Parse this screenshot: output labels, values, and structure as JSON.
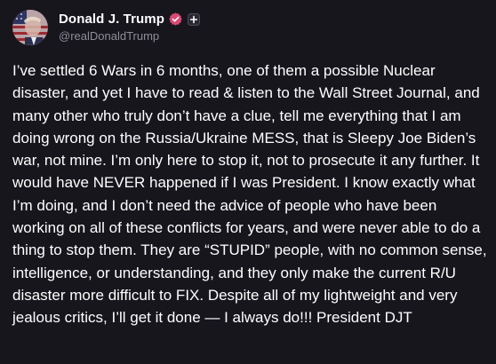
{
  "author": {
    "display_name": "Donald J. Trump",
    "handle": "@realDonaldTrump",
    "avatar_icon": "flag-portrait-avatar",
    "verified_icon": "verified-badge-icon",
    "verified_color": "#d94a73",
    "plus_icon": "plus-box-icon"
  },
  "post": {
    "text": "I’ve settled 6 Wars in 6 months, one of them a possible Nuclear disaster, and yet I have to read & listen to the Wall Street Journal, and many other who truly don’t have a clue, tell me everything that I am doing wrong on the Russia/Ukraine MESS, that is Sleepy Joe Biden’s war, not mine. I’m only here to stop it, not to prosecute it any further. It would have NEVER happened if I was President. I know exactly what I’m doing, and I don’t need the advice of people who have been working on all of these conflicts for years, and were never able to do a thing to stop them. They are “STUPID” people, with no common sense, intelligence, or understanding, and they only make the current R/U disaster more difficult to FIX. Despite all of my lightweight and very jealous critics, I’ll get it done — I always do!!! President DJT"
  },
  "colors": {
    "background": "#17161d",
    "text": "#ffffff",
    "handle": "#8e8c99"
  }
}
